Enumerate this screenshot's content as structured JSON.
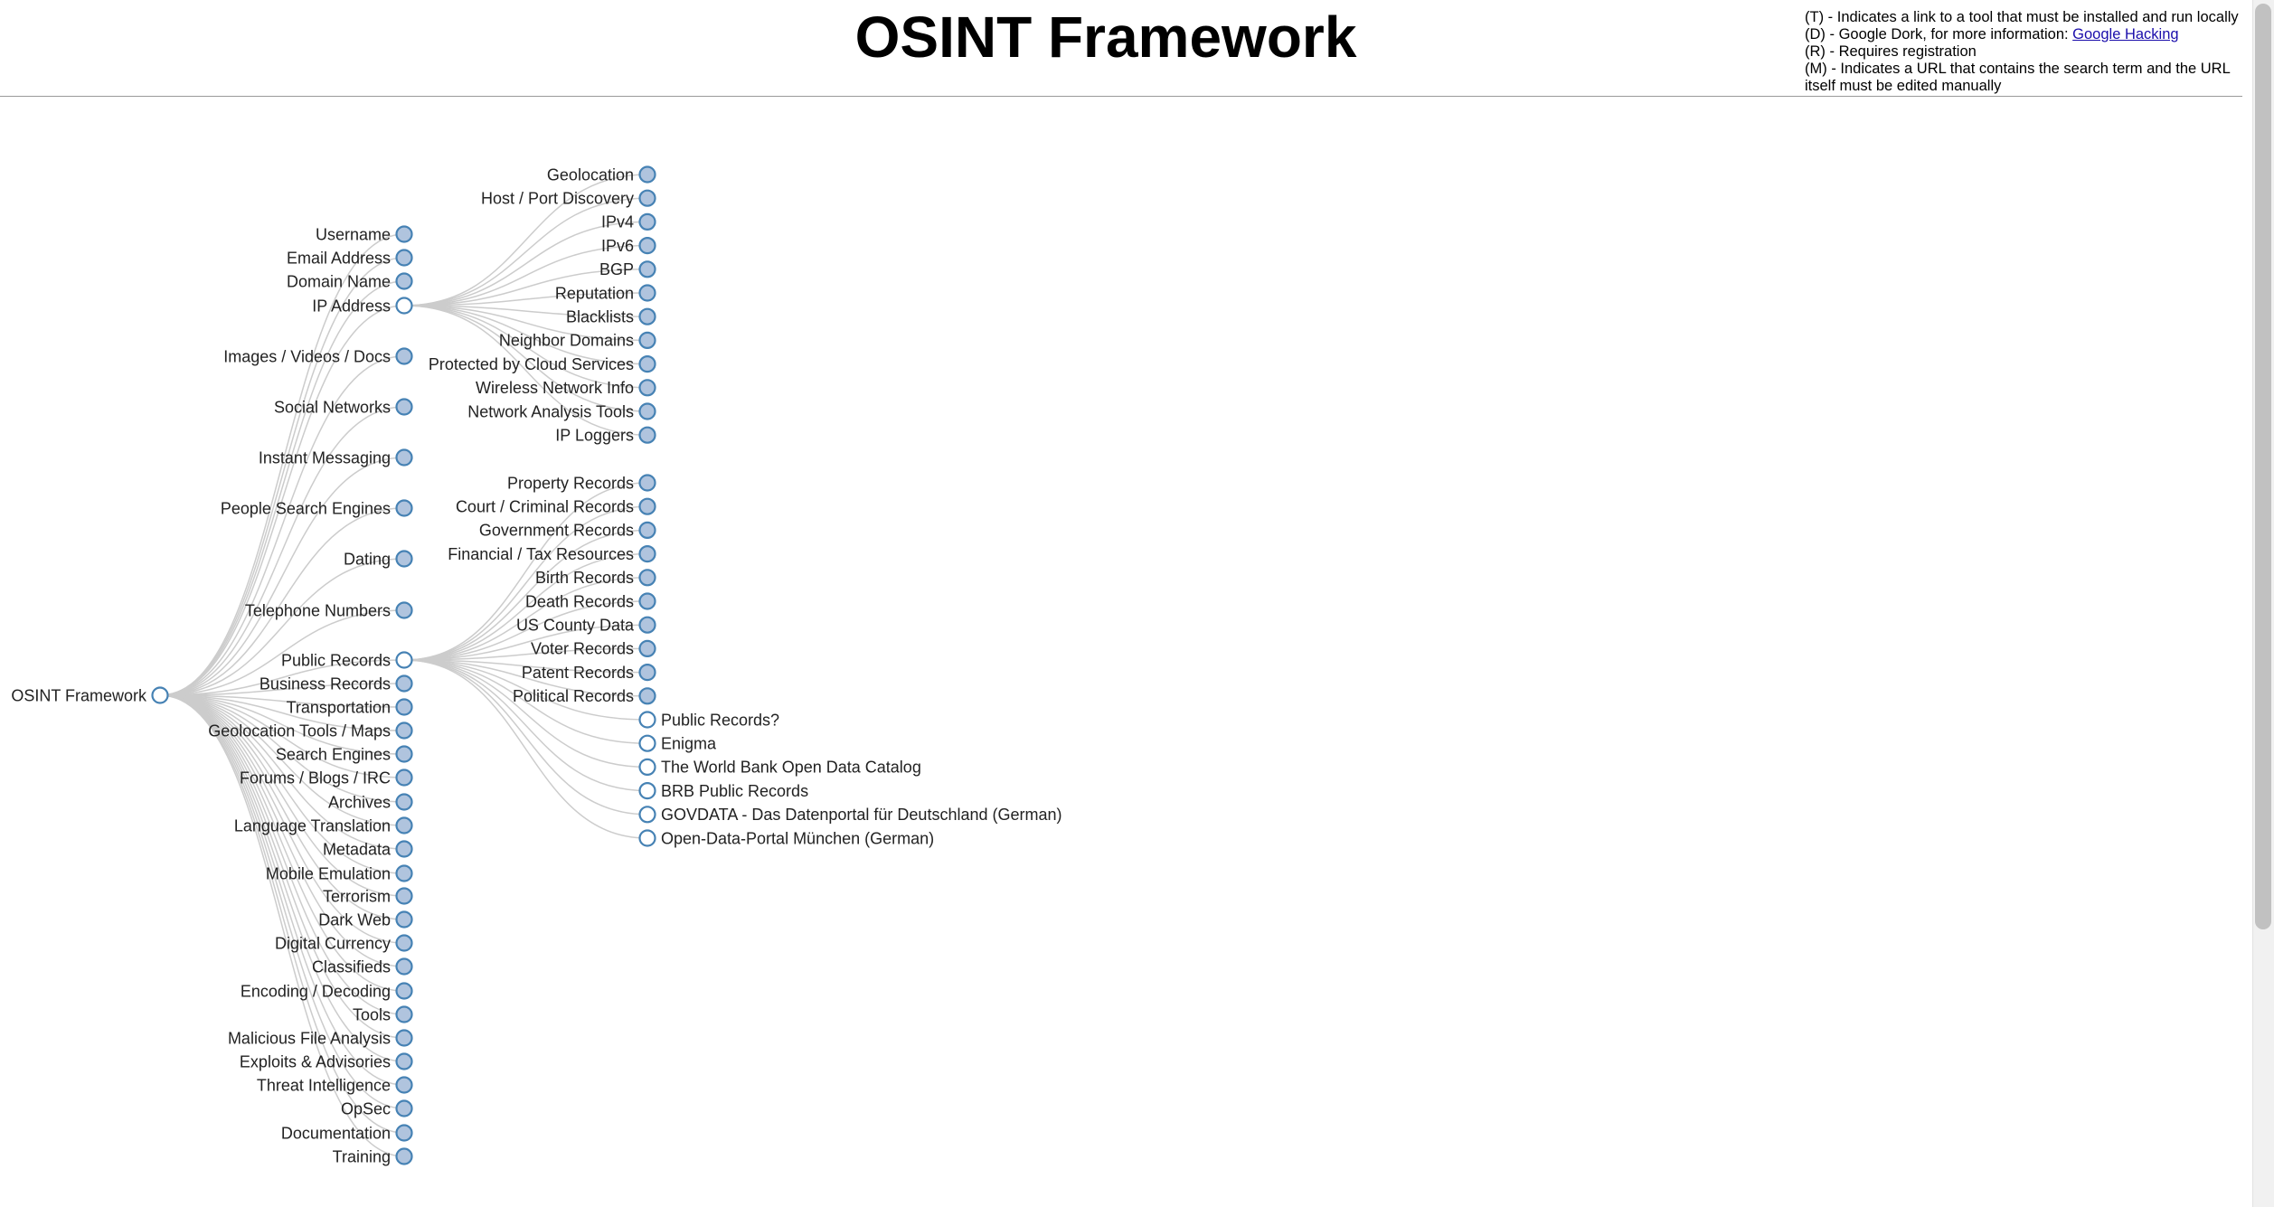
{
  "header": {
    "title": "OSINT Framework"
  },
  "legend": {
    "tool": "(T) - Indicates a link to a tool that must be installed and run locally",
    "dork_prefix": "(D) - Google Dork, for more information: ",
    "dork_link": "Google Hacking",
    "registration": "(R) - Requires registration",
    "manual_url": "(M) - Indicates a URL that contains the search term and the URL itself must be edited manually"
  },
  "colors": {
    "node_stroke": "#4682b4",
    "collapsed_fill": "#b0c4de",
    "expanded_fill": "#ffffff",
    "link": "#cccccc"
  },
  "tree": {
    "name": "OSINT Framework",
    "expanded": true,
    "children": [
      {
        "name": "Username"
      },
      {
        "name": "Email Address"
      },
      {
        "name": "Domain Name"
      },
      {
        "name": "IP Address",
        "expanded": true,
        "children": [
          {
            "name": "Geolocation"
          },
          {
            "name": "Host / Port Discovery"
          },
          {
            "name": "IPv4"
          },
          {
            "name": "IPv6"
          },
          {
            "name": "BGP"
          },
          {
            "name": "Reputation"
          },
          {
            "name": "Blacklists"
          },
          {
            "name": "Neighbor Domains"
          },
          {
            "name": "Protected by Cloud Services"
          },
          {
            "name": "Wireless Network Info"
          },
          {
            "name": "Network Analysis Tools"
          },
          {
            "name": "IP Loggers"
          }
        ]
      },
      {
        "name": "Images / Videos / Docs"
      },
      {
        "name": "Social Networks"
      },
      {
        "name": "Instant Messaging"
      },
      {
        "name": "People Search Engines"
      },
      {
        "name": "Dating"
      },
      {
        "name": "Telephone Numbers"
      },
      {
        "name": "Public Records",
        "expanded": true,
        "children": [
          {
            "name": "Property Records"
          },
          {
            "name": "Court / Criminal Records"
          },
          {
            "name": "Government Records"
          },
          {
            "name": "Financial / Tax Resources"
          },
          {
            "name": "Birth Records"
          },
          {
            "name": "Death Records"
          },
          {
            "name": "US County Data"
          },
          {
            "name": "Voter Records"
          },
          {
            "name": "Patent Records"
          },
          {
            "name": "Political Records"
          },
          {
            "name": "Public Records?",
            "leaf": true
          },
          {
            "name": "Enigma",
            "leaf": true
          },
          {
            "name": "The World Bank Open Data Catalog",
            "leaf": true
          },
          {
            "name": "BRB Public Records",
            "leaf": true
          },
          {
            "name": "GOVDATA - Das Datenportal für Deutschland (German)",
            "leaf": true
          },
          {
            "name": "Open-Data-Portal München (German)",
            "leaf": true
          }
        ]
      },
      {
        "name": "Business Records"
      },
      {
        "name": "Transportation"
      },
      {
        "name": "Geolocation Tools / Maps"
      },
      {
        "name": "Search Engines"
      },
      {
        "name": "Forums / Blogs / IRC"
      },
      {
        "name": "Archives"
      },
      {
        "name": "Language Translation"
      },
      {
        "name": "Metadata"
      },
      {
        "name": "Mobile Emulation"
      },
      {
        "name": "Terrorism"
      },
      {
        "name": "Dark Web"
      },
      {
        "name": "Digital Currency"
      },
      {
        "name": "Classifieds"
      },
      {
        "name": "Encoding / Decoding"
      },
      {
        "name": "Tools"
      },
      {
        "name": "Malicious File Analysis"
      },
      {
        "name": "Exploits & Advisories"
      },
      {
        "name": "Threat Intelligence"
      },
      {
        "name": "OpSec"
      },
      {
        "name": "Documentation"
      },
      {
        "name": "Training"
      }
    ]
  }
}
